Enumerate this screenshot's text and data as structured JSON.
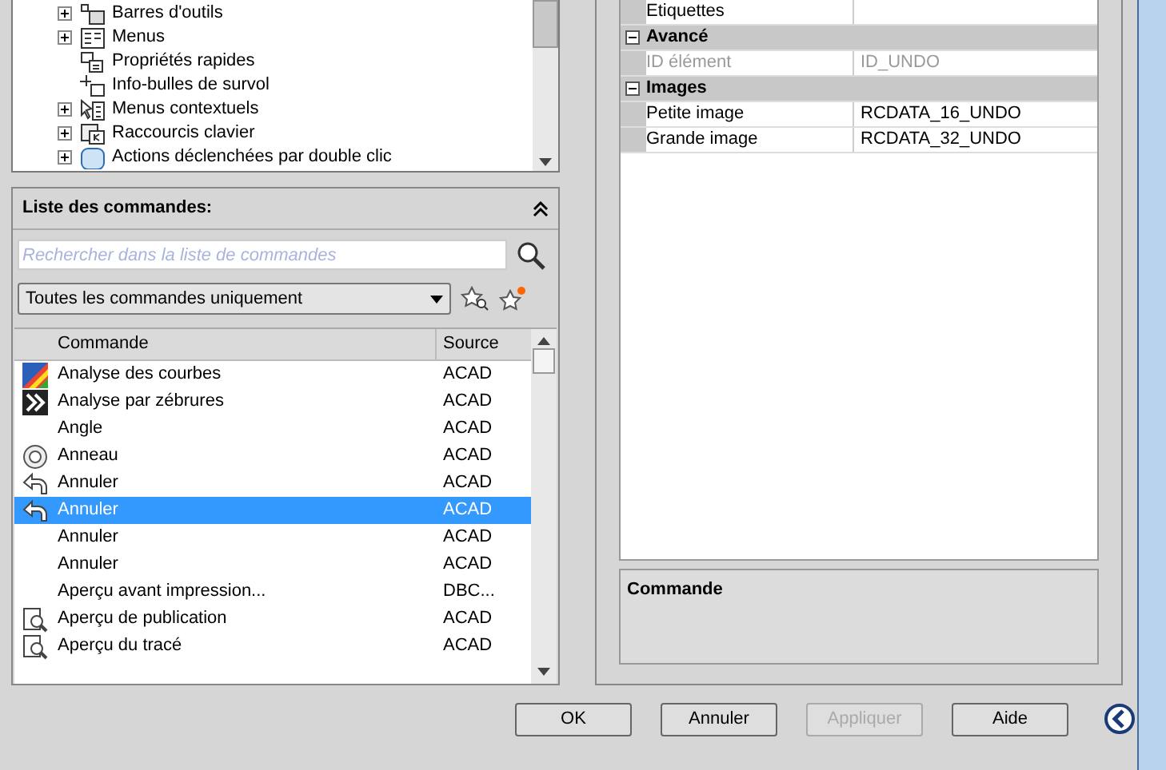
{
  "tree": {
    "items": [
      {
        "label": "Barres d'outils",
        "kind": "toolbar",
        "expanded": false
      },
      {
        "label": "Menus",
        "kind": "menu",
        "expanded": false
      },
      {
        "label": "Propriétés rapides",
        "kind": "quickprops"
      },
      {
        "label": "Info-bulles de survol",
        "kind": "tooltip"
      },
      {
        "label": "Menus contextuels",
        "kind": "context",
        "expanded": false
      },
      {
        "label": "Raccourcis clavier",
        "kind": "keyboard",
        "expanded": false
      },
      {
        "label": "Actions déclenchées par double clic",
        "kind": "dblclick",
        "expanded": false
      }
    ]
  },
  "command_list": {
    "title": "Liste des commandes:",
    "search": {
      "placeholder": "Rechercher dans la liste de commandes"
    },
    "filter": "Toutes les commandes uniquement",
    "columns": [
      "Commande",
      "Source"
    ],
    "rows": [
      {
        "name": "Analyse des courbes",
        "source": "ACAD",
        "kind": "curvature",
        "selected": false
      },
      {
        "name": "Analyse par zébrures",
        "source": "ACAD",
        "kind": "zebra",
        "selected": false
      },
      {
        "name": "Angle",
        "source": "ACAD",
        "kind": "none",
        "selected": false
      },
      {
        "name": "Anneau",
        "source": "ACAD",
        "kind": "ring",
        "selected": false
      },
      {
        "name": "Annuler",
        "source": "ACAD",
        "kind": "undo",
        "selected": false
      },
      {
        "name": "Annuler",
        "source": "ACAD",
        "kind": "undo",
        "selected": true
      },
      {
        "name": "Annuler",
        "source": "ACAD",
        "kind": "none",
        "selected": false
      },
      {
        "name": "Annuler",
        "source": "ACAD",
        "kind": "none",
        "selected": false
      },
      {
        "name": "Aperçu avant impression...",
        "source": "DBC...",
        "kind": "none",
        "selected": false
      },
      {
        "name": "Aperçu de publication",
        "source": "ACAD",
        "kind": "preview",
        "selected": false
      },
      {
        "name": "Aperçu du tracé",
        "source": "ACAD",
        "kind": "preview",
        "selected": false
      }
    ]
  },
  "properties": {
    "rows": [
      {
        "kind": "property",
        "name": "Etiquettes",
        "disabled": false
      },
      {
        "kind": "category",
        "name": "Avancé",
        "expanded": true
      },
      {
        "kind": "property",
        "name": "ID élément",
        "value": "ID_UNDO",
        "disabled": true
      },
      {
        "kind": "category",
        "name": "Images",
        "expanded": true
      },
      {
        "kind": "property",
        "name": "Petite image",
        "value": "RCDATA_16_UNDO",
        "disabled": false
      },
      {
        "kind": "property",
        "name": "Grande image",
        "value": "RCDATA_32_UNDO",
        "disabled": false
      }
    ]
  },
  "description": {
    "title": "Commande"
  },
  "buttons": [
    {
      "label": "OK",
      "disabled": false
    },
    {
      "label": "Annuler",
      "disabled": false
    },
    {
      "label": "Appliquer",
      "disabled": true
    },
    {
      "label": "Aide",
      "disabled": false
    }
  ]
}
